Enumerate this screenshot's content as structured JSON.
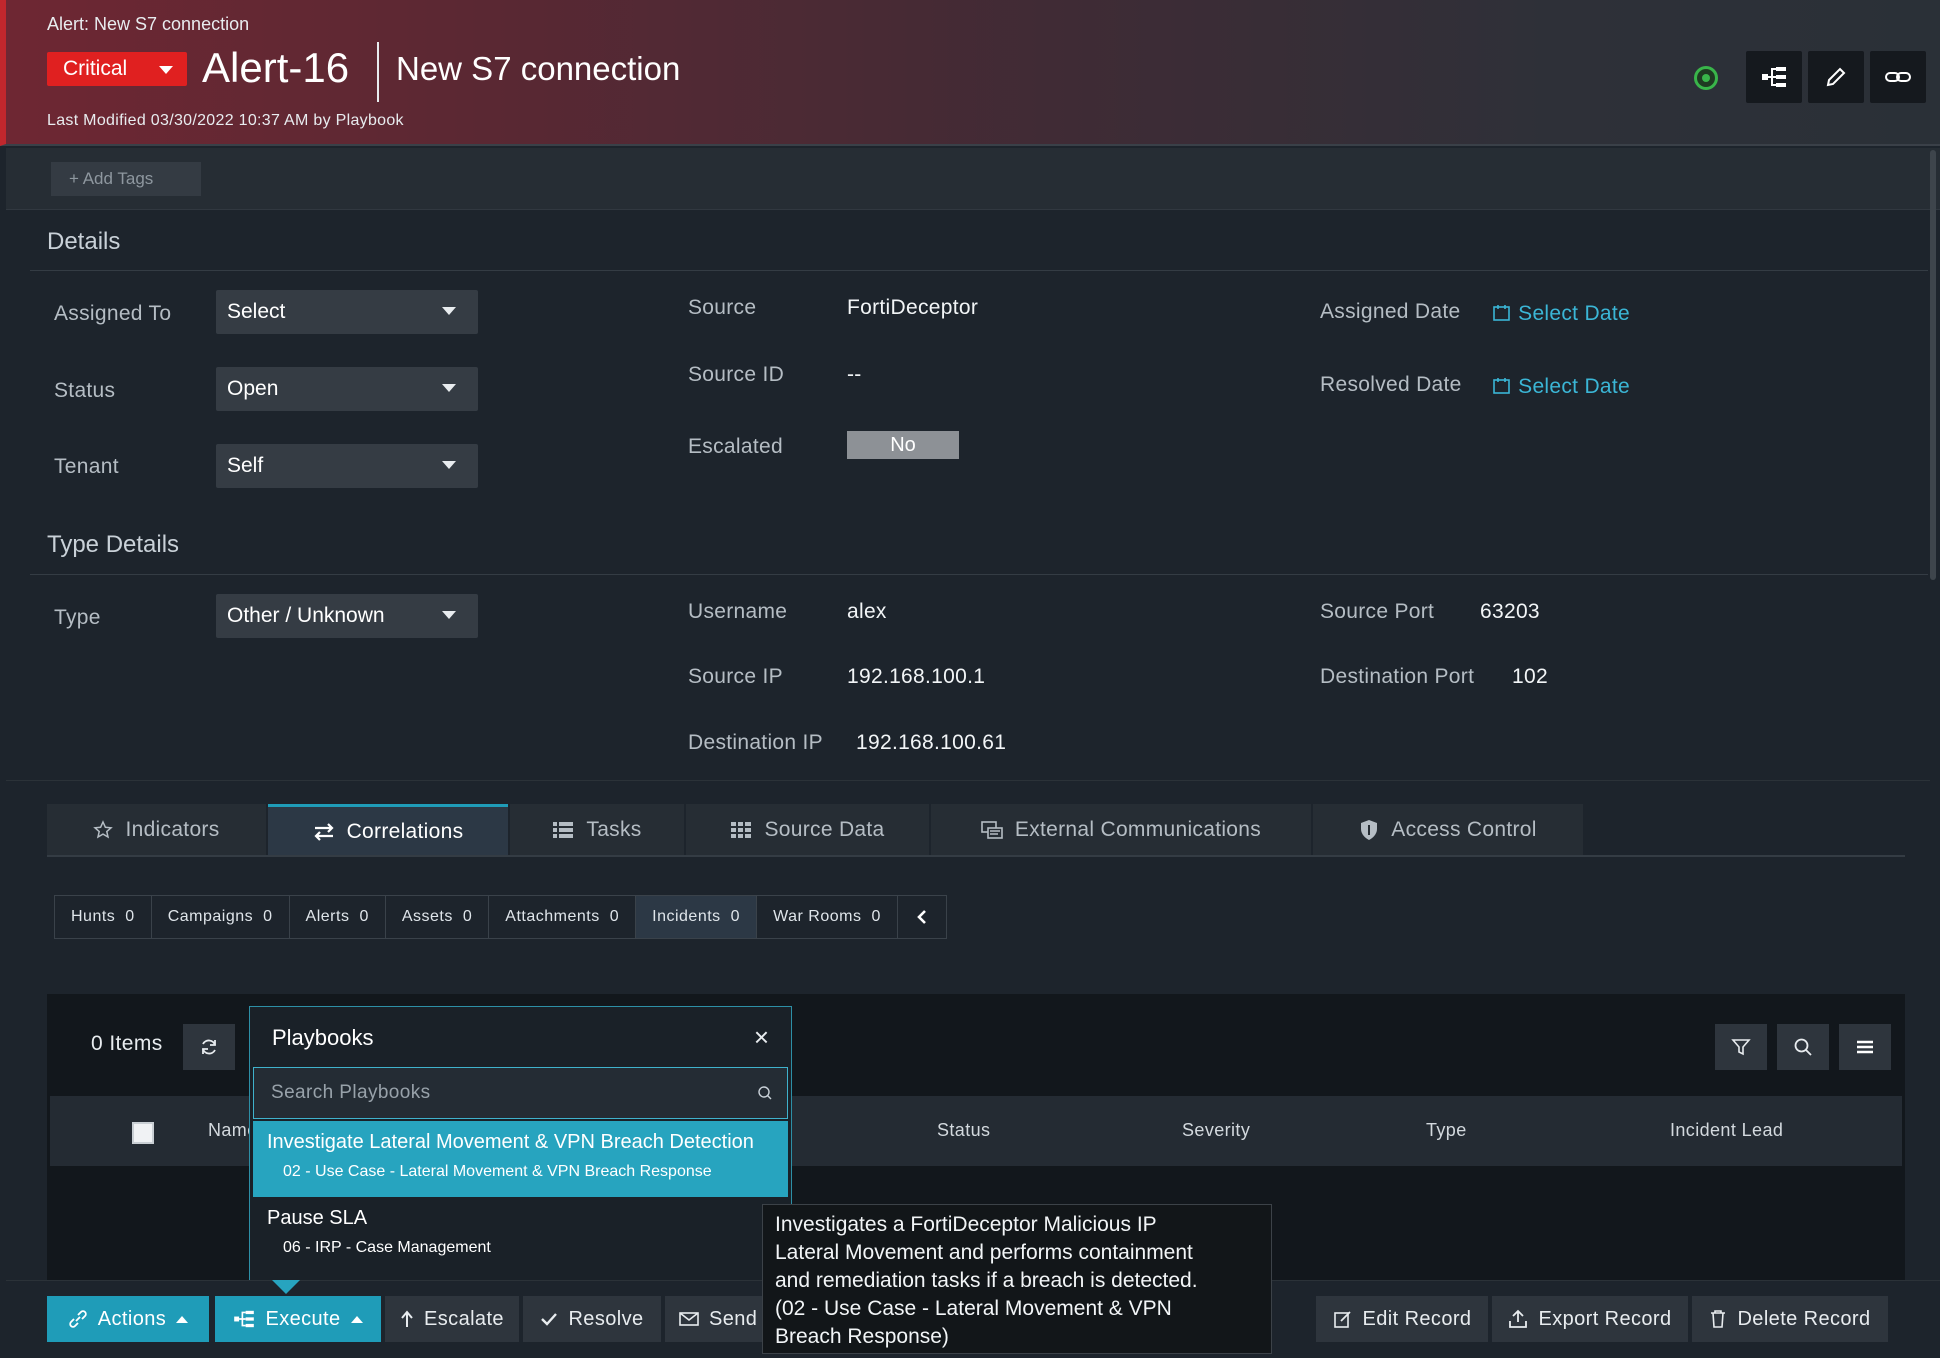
{
  "header": {
    "breadcrumb": "Alert: New S7 connection",
    "severity": "Critical",
    "record_id": "Alert-16",
    "title": "New S7 connection",
    "last_modified": "Last Modified 03/30/2022 10:37 AM by Playbook",
    "icons": [
      "playbook-status-icon",
      "execute-tree-icon",
      "edit-pencil-icon",
      "link-icon"
    ]
  },
  "tags": {
    "add_label": "+ Add Tags"
  },
  "details": {
    "title": "Details",
    "assigned_to": {
      "label": "Assigned To",
      "value": "Select"
    },
    "status": {
      "label": "Status",
      "value": "Open"
    },
    "tenant": {
      "label": "Tenant",
      "value": "Self"
    },
    "source": {
      "label": "Source",
      "value": "FortiDeceptor"
    },
    "source_id": {
      "label": "Source ID",
      "value": "--"
    },
    "escalated": {
      "label": "Escalated",
      "value": "No"
    },
    "assigned_date": {
      "label": "Assigned Date",
      "value": "Select Date"
    },
    "resolved_date": {
      "label": "Resolved Date",
      "value": "Select Date"
    }
  },
  "type_details": {
    "title": "Type Details",
    "type": {
      "label": "Type",
      "value": "Other / Unknown"
    },
    "username": {
      "label": "Username",
      "value": "alex"
    },
    "source_ip": {
      "label": "Source IP",
      "value": "192.168.100.1"
    },
    "destination_ip": {
      "label": "Destination IP",
      "value": "192.168.100.61"
    },
    "source_port": {
      "label": "Source Port",
      "value": "63203"
    },
    "destination_port": {
      "label": "Destination Port",
      "value": "102"
    }
  },
  "tabs": [
    {
      "label": "Indicators",
      "icon": "star-icon"
    },
    {
      "label": "Correlations",
      "icon": "swap-arrows-icon",
      "active": true
    },
    {
      "label": "Tasks",
      "icon": "list-icon"
    },
    {
      "label": "Source Data",
      "icon": "grid-icon"
    },
    {
      "label": "External Communications",
      "icon": "communications-icon"
    },
    {
      "label": "Access Control",
      "icon": "shield-icon"
    }
  ],
  "subtabs": [
    {
      "label": "Hunts",
      "count": "0"
    },
    {
      "label": "Campaigns",
      "count": "0"
    },
    {
      "label": "Alerts",
      "count": "0"
    },
    {
      "label": "Assets",
      "count": "0"
    },
    {
      "label": "Attachments",
      "count": "0"
    },
    {
      "label": "Incidents",
      "count": "0",
      "active": true
    },
    {
      "label": "War Rooms",
      "count": "0"
    }
  ],
  "grid": {
    "items_label": "0 Items",
    "columns": [
      "Name",
      "Status",
      "Severity",
      "Type",
      "Incident Lead"
    ]
  },
  "playbooks": {
    "title": "Playbooks",
    "close": "×",
    "search_placeholder": "Search Playbooks",
    "items": [
      {
        "name": "Investigate Lateral Movement & VPN Breach Detection",
        "collection": "02 - Use Case - Lateral Movement & VPN Breach Response",
        "highlighted": true
      },
      {
        "name": "Pause SLA",
        "collection": "06 - IRP - Case Management"
      }
    ]
  },
  "tooltip": {
    "lines": [
      "Investigates a FortiDeceptor Malicious IP",
      "Lateral Movement and performs containment",
      "and remediation tasks if a breach is detected.",
      "(02 - Use Case - Lateral Movement & VPN",
      "Breach Response)"
    ]
  },
  "actions": {
    "actions": "Actions",
    "execute": "Execute",
    "escalate": "Escalate",
    "resolve": "Resolve",
    "send": "Send",
    "edit": "Edit Record",
    "export": "Export Record",
    "delete": "Delete Record"
  },
  "colors": {
    "critical": "#e02020",
    "accent": "#1f9cb8",
    "link": "#3bb6d6",
    "status_ok": "#39b54a"
  }
}
